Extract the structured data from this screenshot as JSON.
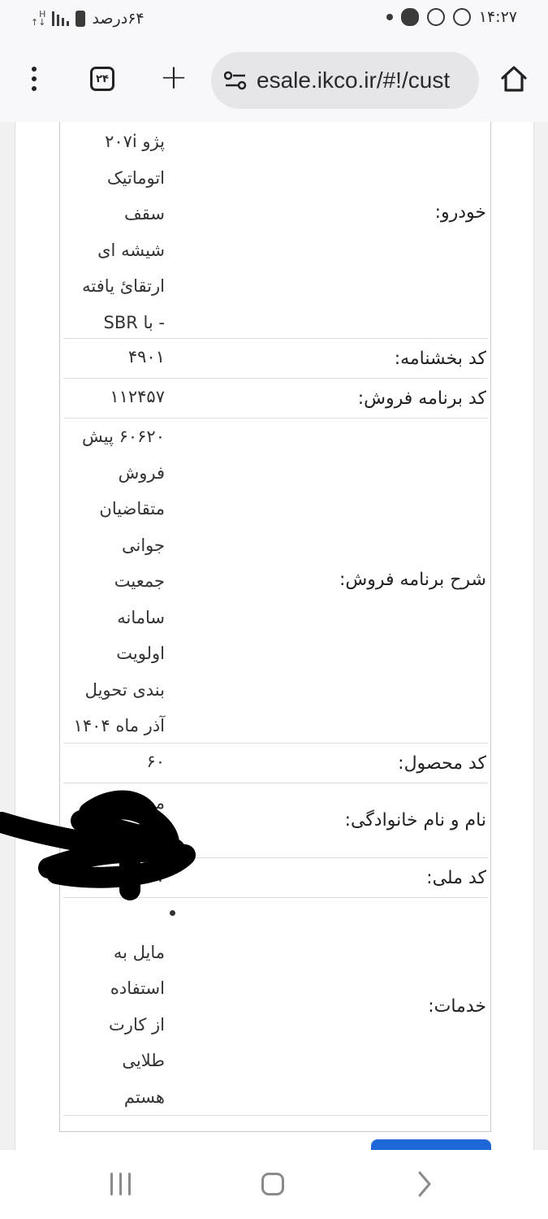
{
  "status_bar": {
    "time": "۱۴:۲۷",
    "battery_text": "۶۴درصد"
  },
  "browser": {
    "url": "esale.ikco.ir/#!/cust",
    "tab_count": "۲۴"
  },
  "details": [
    {
      "label": "خودرو:",
      "value_lines": [
        "پژو ۲۰۷i",
        "اتوماتیک",
        "سقف",
        "شیشه ای",
        "ارتقائ یافته",
        "- با SBR"
      ]
    },
    {
      "label": "کد بخشنامه:",
      "value_lines": [
        "۴۹۰۱"
      ]
    },
    {
      "label": "کد برنامه فروش:",
      "value_lines": [
        "۱۱۲۴۵۷"
      ]
    },
    {
      "label": "شرح برنامه فروش:",
      "value_lines": [
        "۶۰۶۲۰ پیش",
        "فروش",
        "متقاضیان",
        "جوانی",
        "جمعیت",
        "سامانه",
        "اولویت",
        "بندی تحویل",
        "آذر ماه ۱۴۰۴"
      ]
    },
    {
      "label": "کد محصول:",
      "value_lines": [
        "۶۰"
      ]
    },
    {
      "label": "نام و نام خانوادگی:",
      "value_lines": [
        "مع"
      ]
    },
    {
      "label": "کد ملی:",
      "value_lines": [
        "۲۷"
      ]
    },
    {
      "label": "خدمات:",
      "value_lines": [
        "",
        "مایل به",
        "استفاده",
        "از کارت",
        "طلایی",
        "هستم"
      ]
    }
  ],
  "colors": {
    "submit_button": "#1f66d6",
    "redaction": "#000000"
  }
}
